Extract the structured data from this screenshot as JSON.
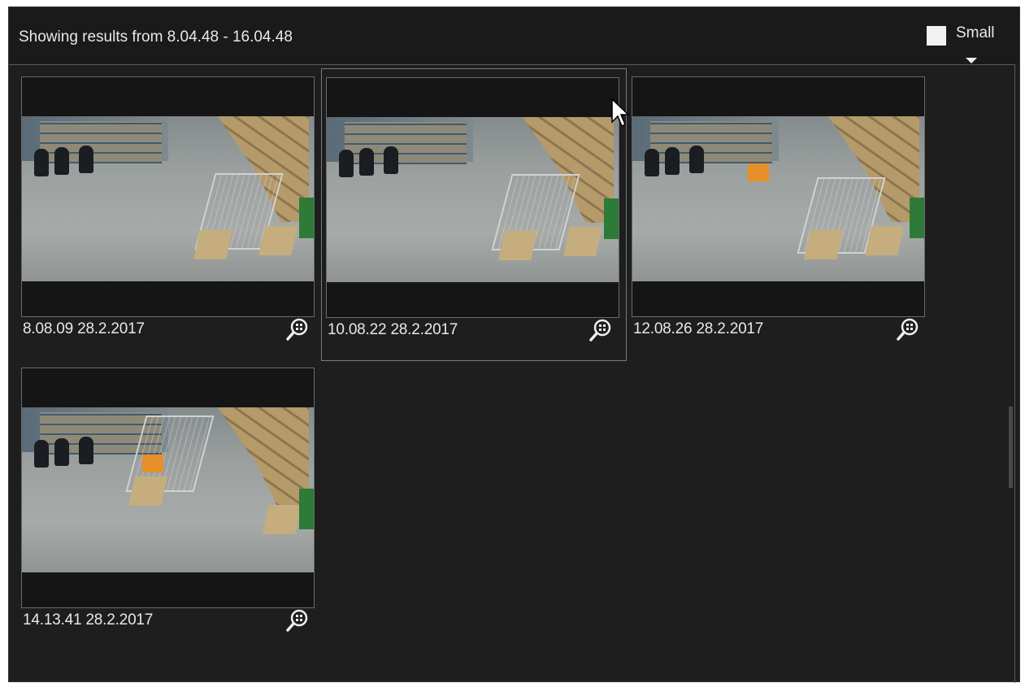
{
  "header": {
    "title": "Showing results from 8.04.48 - 16.04.48",
    "size_label": "Small"
  },
  "results": [
    {
      "caption": "8.08.09  28.2.2017",
      "selected": false
    },
    {
      "caption": "10.08.22  28.2.2017",
      "selected": true
    },
    {
      "caption": "12.08.26  28.2.2017",
      "selected": false
    },
    {
      "caption": "14.13.41  28.2.2017",
      "selected": false
    }
  ],
  "icons": {
    "zoom": "zoom-magnifier-icon",
    "dropdown": "caret-down-icon",
    "cursor": "mouse-pointer-icon"
  },
  "colors": {
    "panel_bg": "#1e1e1e",
    "text": "#e8e8e8",
    "thumb_border": "#6a6a6a",
    "selected_border": "#7a7a7a"
  }
}
